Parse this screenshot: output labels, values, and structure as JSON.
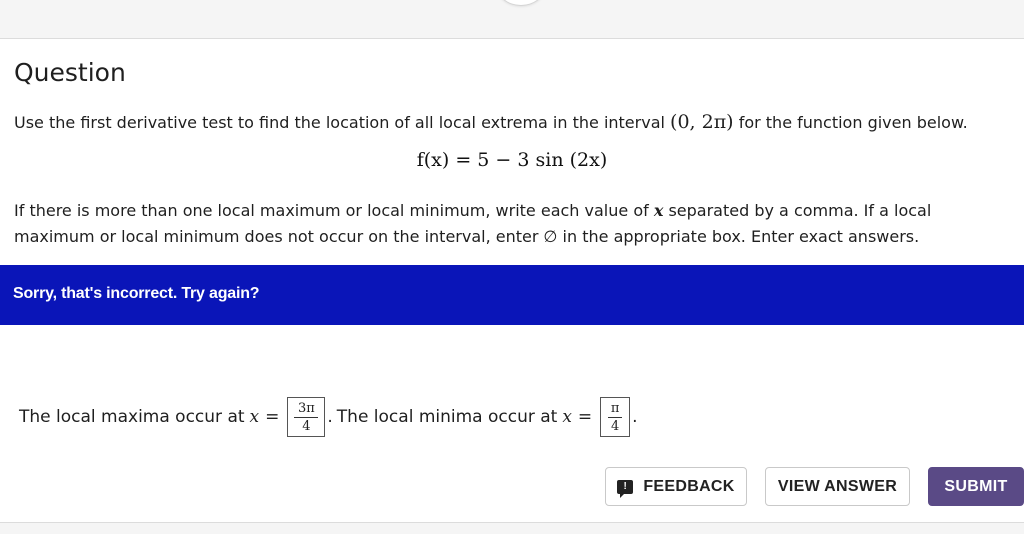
{
  "question": {
    "title": "Question",
    "intro_before": "Use the first derivative test to find the location of all local extrema in the interval ",
    "interval": "(0, 2π)",
    "intro_after": " for the function given below.",
    "equation": "f(x) = 5 − 3 sin (2x)",
    "instructions_part1": "If there is more than one local maximum or local minimum, write each value of ",
    "instructions_var": "x",
    "instructions_part2": " separated by a comma. If a local maximum or local minimum does not occur on the interval, enter ∅ in the appropriate box. Enter exact answers."
  },
  "feedback_banner": {
    "text": "Sorry, that's incorrect. Try again?",
    "color": "#0a15b8"
  },
  "answers": {
    "maxima_label": "The local maxima occur at",
    "maxima_var": "x",
    "equals": "=",
    "maxima_numerator": "3π",
    "maxima_denominator": "4",
    "period": ".",
    "minima_label": "The local minima occur at",
    "minima_var": "x",
    "minima_numerator": "π",
    "minima_denominator": "4"
  },
  "buttons": {
    "feedback_icon": "!",
    "feedback_label": "FEEDBACK",
    "view_answer_label": "VIEW ANSWER",
    "submit_label": "SUBMIT",
    "submit_color": "#5a4a86"
  },
  "icons": {
    "feedback": "speech-bubble-exclamation-icon"
  }
}
